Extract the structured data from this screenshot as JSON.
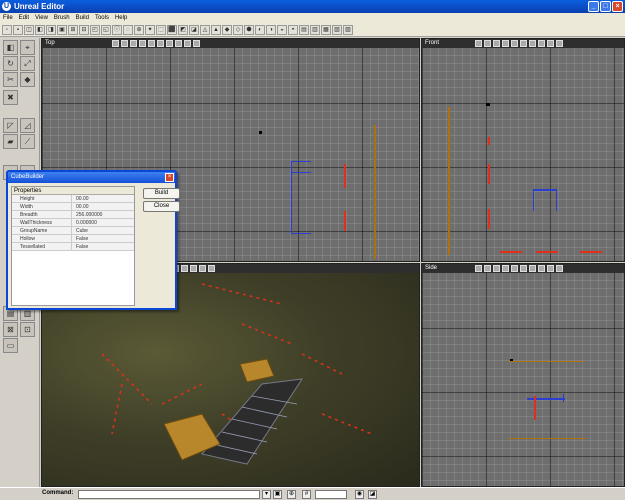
{
  "window": {
    "title": "Unreal Editor",
    "min": "_",
    "max": "□",
    "close": "×"
  },
  "menu": [
    "File",
    "Edit",
    "View",
    "Brush",
    "Build",
    "Tools",
    "Help"
  ],
  "toolbar": {
    "button_count": 32
  },
  "viewports": {
    "top": {
      "label": "Top"
    },
    "front": {
      "label": "Front"
    },
    "side": {
      "label": "Side"
    },
    "perspective": {
      "label": ""
    }
  },
  "dialog": {
    "title": "CubeBuilder",
    "close": "×",
    "group": "Properties",
    "properties": [
      {
        "key": "Height",
        "value": "00.00"
      },
      {
        "key": "Width",
        "value": "00.00"
      },
      {
        "key": "Breadth",
        "value": "256.000000"
      },
      {
        "key": "WallThickness",
        "value": "0.000000"
      },
      {
        "key": "GroupName",
        "value": "Cube"
      },
      {
        "key": "Hollow",
        "value": "False"
      },
      {
        "key": "Tessellated",
        "value": "False"
      }
    ],
    "build_button": "Build",
    "close_button": "Close"
  },
  "statusbar": {
    "command_label": "Command:",
    "command_value": "",
    "select_value": ""
  },
  "colors": {
    "accent_blue": "#0a46d8",
    "brush_red": "#e0301c",
    "brush_blue": "#2a3fd0",
    "bsp_orange": "#b07010"
  }
}
